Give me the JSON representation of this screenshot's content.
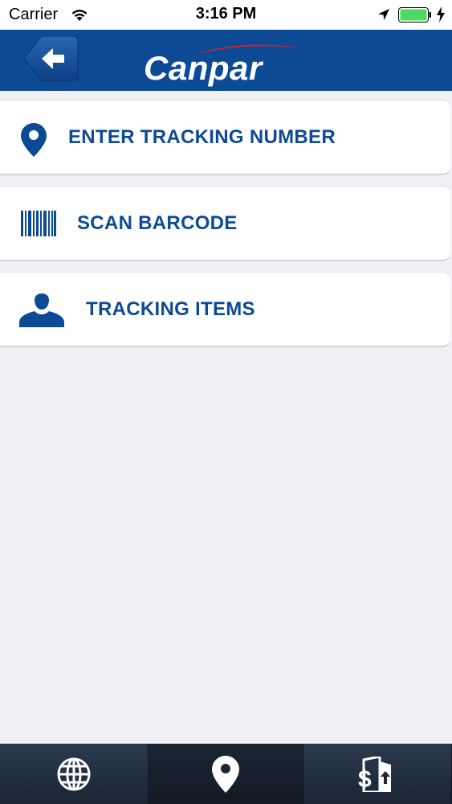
{
  "status_bar": {
    "carrier": "Carrier",
    "time": "3:16 PM",
    "wifi_icon": "wifi-icon",
    "location_icon": "location-arrow-icon",
    "battery_icon": "battery-icon",
    "charging_icon": "charging-bolt-icon",
    "battery_color": "#4cd964"
  },
  "header": {
    "back_icon": "back-arrow-icon",
    "logo_text": "Canpar",
    "background": "#0d4a96",
    "swoosh_color": "#d22030"
  },
  "menu": {
    "items": [
      {
        "label": "ENTER TRACKING NUMBER",
        "icon": "map-pin-icon"
      },
      {
        "label": "SCAN BARCODE",
        "icon": "barcode-icon"
      },
      {
        "label": "TRACKING ITEMS",
        "icon": "person-icon"
      }
    ],
    "label_color": "#0d4a96"
  },
  "tab_bar": {
    "tabs": [
      {
        "icon": "globe-icon",
        "active": false
      },
      {
        "icon": "map-pin-icon",
        "active": true
      },
      {
        "icon": "dollar-building-icon",
        "active": false
      }
    ]
  }
}
